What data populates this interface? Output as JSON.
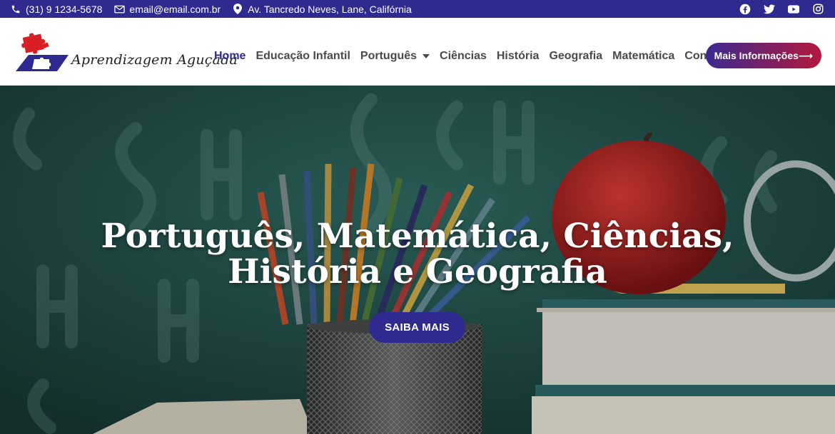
{
  "topbar": {
    "phone": "(31) 9 1234-5678",
    "email": "email@email.com.br",
    "address": "Av. Tancredo Neves, Lane, Califórnia",
    "socials": [
      "facebook-icon",
      "twitter-icon",
      "youtube-icon",
      "instagram-icon"
    ]
  },
  "header": {
    "logo_text": "Aprendizagem Aguçada",
    "nav": [
      {
        "label": "Home",
        "active": true
      },
      {
        "label": "Educação Infantil"
      },
      {
        "label": "Português",
        "has_dropdown": true
      },
      {
        "label": "Ciências"
      },
      {
        "label": "História"
      },
      {
        "label": "Geografia"
      },
      {
        "label": "Matemática"
      },
      {
        "label": "Contato"
      }
    ],
    "cta_label": "Mais Informações⟶"
  },
  "hero": {
    "title_line1": "Português, Matemática, Ciências,",
    "title_line2": "História e Geografia",
    "button_label": "SAIBA MAIS"
  },
  "colors": {
    "brand": "#2e2a8f",
    "accent": "#b3183c",
    "logo_red": "#d81f26",
    "chalkboard": "#1e3b37"
  }
}
